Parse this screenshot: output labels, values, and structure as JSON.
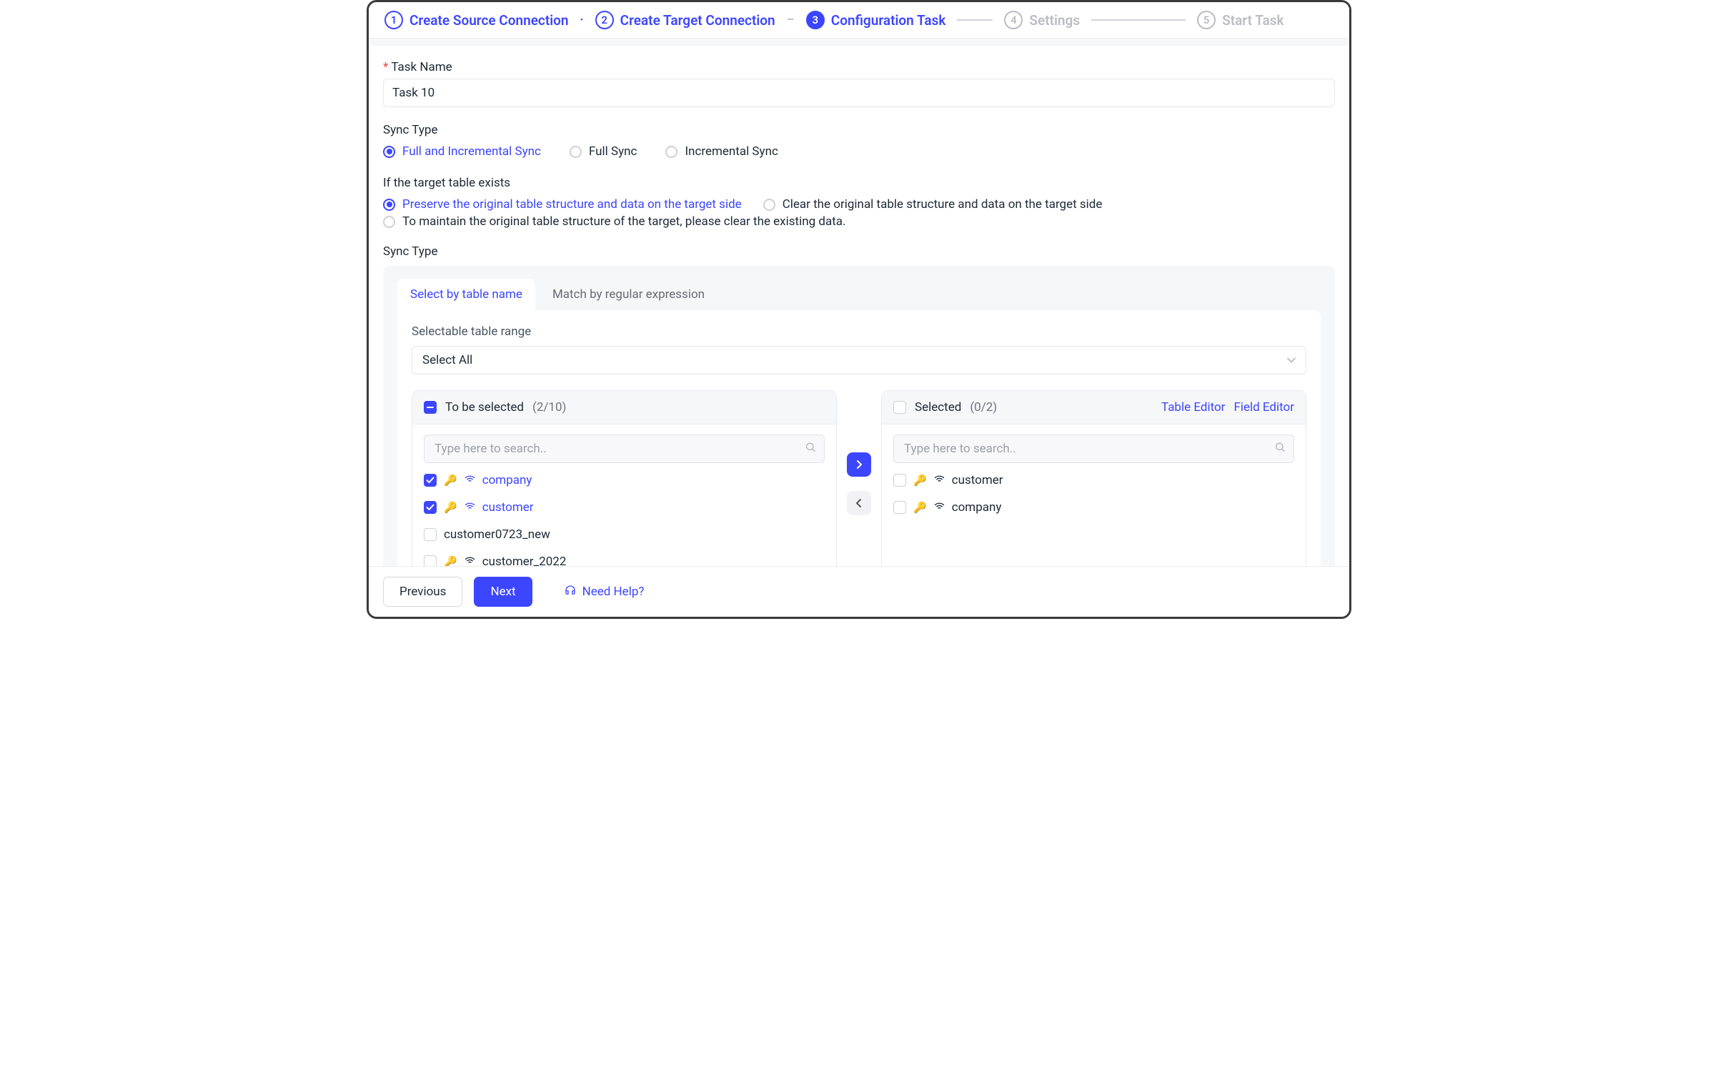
{
  "stepper": {
    "steps": [
      {
        "num": "1",
        "label": "Create Source Connection",
        "state": "done"
      },
      {
        "num": "2",
        "label": "Create Target Connection",
        "state": "done"
      },
      {
        "num": "3",
        "label": "Configuration Task",
        "state": "current"
      },
      {
        "num": "4",
        "label": "Settings",
        "state": "pending"
      },
      {
        "num": "5",
        "label": "Start Task",
        "state": "pending"
      }
    ]
  },
  "form": {
    "task_name_label": "Task Name",
    "task_name_value": "Task 10",
    "sync_type_label": "Sync Type",
    "sync_options": {
      "full_incremental": "Full and Incremental Sync",
      "full": "Full Sync",
      "incremental": "Incremental Sync"
    },
    "target_exists_label": "If the target table exists",
    "target_options": {
      "preserve": "Preserve the original table structure and data on the target side",
      "clear": "Clear the original table structure and data on the target side",
      "maintain_clear": "To maintain the original table structure of the target, please clear the existing data."
    },
    "sync_type_label2": "Sync Type"
  },
  "tabs": {
    "select_by_name": "Select by table name",
    "match_regex": "Match by regular expression"
  },
  "table_range": {
    "label": "Selectable table range",
    "value": "Select All"
  },
  "left_list": {
    "title": "To be selected",
    "count": "(2/10)",
    "search_placeholder": "Type here to search..",
    "rows": [
      {
        "name": "company",
        "checked": true,
        "key": true,
        "wifi": true
      },
      {
        "name": "customer",
        "checked": true,
        "key": true,
        "wifi": true
      },
      {
        "name": "customer0723_new",
        "checked": false,
        "key": false,
        "wifi": false
      },
      {
        "name": "customer_2022",
        "checked": false,
        "key": true,
        "wifi": true
      }
    ]
  },
  "right_list": {
    "title": "Selected",
    "count": "(0/2)",
    "table_editor": "Table Editor",
    "field_editor": "Field Editor",
    "search_placeholder": "Type here to search..",
    "rows": [
      {
        "name": "customer",
        "checked": false,
        "key": true,
        "wifi": true
      },
      {
        "name": "company",
        "checked": false,
        "key": true,
        "wifi": true
      }
    ]
  },
  "footer": {
    "previous": "Previous",
    "next": "Next",
    "help": "Need Help?"
  }
}
